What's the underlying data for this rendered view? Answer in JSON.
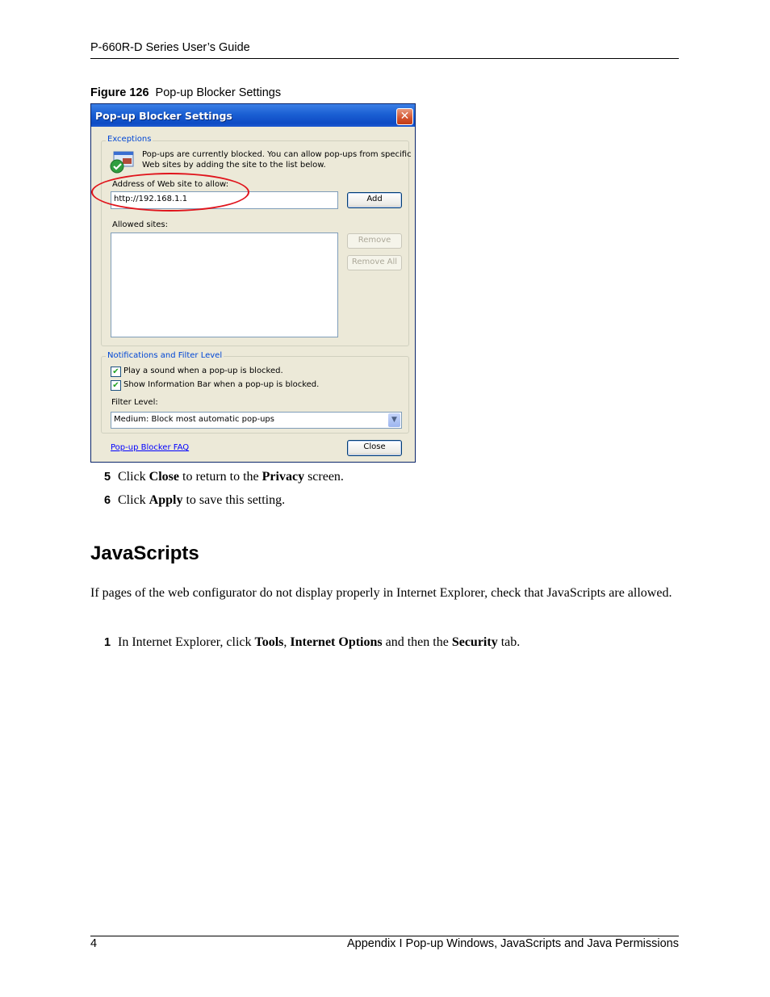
{
  "header": {
    "title": "P-660R-D Series User’s Guide"
  },
  "figure": {
    "label": "Figure 126",
    "caption": "Pop-up Blocker Settings"
  },
  "dialog": {
    "title": "Pop-up Blocker Settings",
    "close_glyph": "✕",
    "exceptions_label": "Exceptions",
    "info_line1": "Pop-ups are currently blocked.  You can allow pop-ups from specific",
    "info_line2": "Web sites by adding the site to the list below.",
    "address_label": "Address of Web site to allow:",
    "address_value": "http://192.168.1.1",
    "add_label": "Add",
    "allowed_label": "Allowed sites:",
    "remove_label": "Remove",
    "remove_all_label": "Remove All",
    "notifications_label": "Notifications and Filter Level",
    "play_sound_label": "Play a sound when a pop-up is blocked.",
    "play_sound_checked": true,
    "info_bar_label": "Show Information Bar when a pop-up is blocked.",
    "info_bar_checked": true,
    "filter_level_label": "Filter Level:",
    "filter_level_value": "Medium: Block most automatic pop-ups",
    "faq_link": "Pop-up Blocker FAQ",
    "close_label": "Close",
    "icons": [
      "shield-check-icon",
      "chevron-down-icon",
      "close-icon"
    ]
  },
  "steps_before": [
    {
      "num": "5",
      "t1": "Click ",
      "b1": "Close",
      "t2": " to return to the ",
      "b2": "Privacy",
      "t3": " screen."
    },
    {
      "num": "6",
      "t1": "Click ",
      "b1": "Apply",
      "t2": " to save this setting."
    }
  ],
  "section": {
    "heading": "JavaScripts",
    "paragraph": "If pages of the web configurator do not display properly in Internet Explorer, check that JavaScripts are allowed."
  },
  "step_1": {
    "num": "1",
    "t1": "In Internet Explorer, click ",
    "b1": "Tools",
    "t2": ", ",
    "b2": "Internet Options",
    "t3": " and then the ",
    "b3": "Security",
    "t4": " tab."
  },
  "footer": {
    "page": "4",
    "title": "Appendix I Pop-up Windows, JavaScripts and Java Permissions"
  },
  "colors": {
    "titlebar": "#0e4bc4",
    "highlight_ellipse": "#e0141c",
    "group_label": "#0046d5",
    "link": "#0000ff"
  }
}
